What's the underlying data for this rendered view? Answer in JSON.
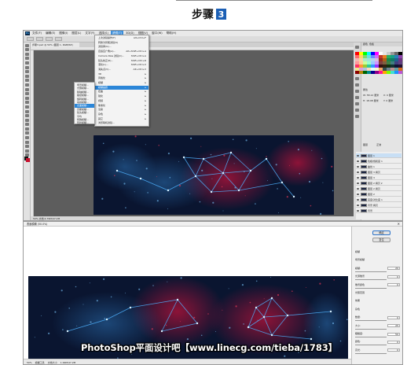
{
  "heading": {
    "step_text": "步骤",
    "step_number": "3"
  },
  "window1": {
    "menu_items": [
      "文件(F)",
      "编辑(E)",
      "图像(I)",
      "图层(L)",
      "文字(Y)",
      "选择(S)",
      "滤镜(T)",
      "3D(D)",
      "视图(V)",
      "窗口(W)",
      "帮助(H)"
    ],
    "active_menu_index": 6,
    "tab_title": "步骤3.psd @ 50% (图层 1, RGB/8#)",
    "status_text": "50%   文档:4.79M/47.2M",
    "right_tabs": [
      "颜色",
      "色板"
    ],
    "properties_title": "属性",
    "properties_rows": [
      "W: 58.12 厘米",
      "X: 0 厘米",
      "H: 18.08 厘米",
      "Y: 0 厘米"
    ],
    "layers_title": "图层",
    "layers_mode": "正常",
    "layers": [
      {
        "name": "图层 1",
        "selected": true
      },
      {
        "name": "色相/饱和度 1",
        "selected": false
      },
      {
        "name": "曲线 1",
        "selected": false
      },
      {
        "name": "图层 3 拷贝",
        "selected": false
      },
      {
        "name": "图层 3",
        "selected": false
      },
      {
        "name": "图层 2 拷贝 2",
        "selected": false
      },
      {
        "name": "图层 2 拷贝",
        "selected": false
      },
      {
        "name": "图层 2",
        "selected": false
      },
      {
        "name": "亮度/对比度 1",
        "selected": false
      },
      {
        "name": "背景 拷贝",
        "selected": false
      },
      {
        "name": "背景",
        "selected": false
      }
    ]
  },
  "filter_menu": {
    "items": [
      {
        "label": "上次滤镜操作(F)",
        "shortcut": "Alt+Ctrl+F"
      },
      {
        "label": "转换为智能滤镜(S)",
        "shortcut": ""
      },
      {
        "label": "滤镜库(G)...",
        "shortcut": ""
      },
      {
        "label": "自适应广角(A)...",
        "shortcut": "Alt+Shift+Ctrl+A"
      },
      {
        "label": "Camera Raw 滤镜(C)...",
        "shortcut": "Shift+Ctrl+A"
      },
      {
        "label": "镜头校正(R)...",
        "shortcut": "Shift+Ctrl+R"
      },
      {
        "label": "液化(L)...",
        "shortcut": "Shift+Ctrl+X"
      },
      {
        "label": "消失点(V)...",
        "shortcut": "Alt+Ctrl+V"
      },
      {
        "label": "3D",
        "shortcut": "▸"
      },
      {
        "label": "风格化",
        "shortcut": "▸"
      },
      {
        "label": "模糊",
        "shortcut": "▸"
      },
      {
        "label": "模糊画廊",
        "shortcut": "▸"
      },
      {
        "label": "扭曲",
        "shortcut": "▸"
      },
      {
        "label": "锐化",
        "shortcut": "▸"
      },
      {
        "label": "视频",
        "shortcut": "▸"
      },
      {
        "label": "像素化",
        "shortcut": "▸"
      },
      {
        "label": "渲染",
        "shortcut": "▸"
      },
      {
        "label": "杂色",
        "shortcut": "▸"
      },
      {
        "label": "其它",
        "shortcut": "▸"
      },
      {
        "label": "浏览联机滤镜...",
        "shortcut": ""
      }
    ],
    "highlighted_index": 11
  },
  "submenu": {
    "items": [
      "场景模糊...",
      "光圈模糊...",
      "移轴模糊...",
      "路径模糊...",
      "旋转模糊...",
      "动感模糊...",
      "表面模糊...",
      "高斯模糊...",
      "镜头模糊...",
      "平均",
      "特殊模糊...",
      "形状模糊..."
    ],
    "highlighted_index": 6
  },
  "window2": {
    "title": "表面模糊 (50.0%)",
    "bottom_bar": [
      "50%",
      "模糊工具",
      "文档大小",
      "1.99M/47.2M"
    ],
    "ok_label": "确定",
    "reset_label": "复位",
    "dialog_rows": [
      {
        "label": "模糊",
        "value": ""
      },
      {
        "label": "场景模糊",
        "value": ""
      },
      {
        "label": "模糊:",
        "value": "20"
      },
      {
        "label": "光源散景",
        "value": "0"
      },
      {
        "label": "散景颜色",
        "value": "0"
      },
      {
        "label": "光照范围",
        "value": ""
      },
      {
        "label": "效果",
        "value": ""
      },
      {
        "label": "杂色",
        "value": ""
      },
      {
        "label": "数量:",
        "value": "0"
      },
      {
        "label": "大小:",
        "value": "25"
      },
      {
        "label": "粗糙度:",
        "value": "50"
      },
      {
        "label": "颜色:",
        "value": "0"
      },
      {
        "label": "高光:",
        "value": "0"
      }
    ]
  },
  "watermark": "PhotoShop平面设计吧【www.linecg.com/tieba/1783】",
  "colors": {
    "accent": "#2b86d8",
    "canvas_bg": "#0a1530",
    "line_blue": "#4fb3ff",
    "glow_red": "#b8123a"
  }
}
